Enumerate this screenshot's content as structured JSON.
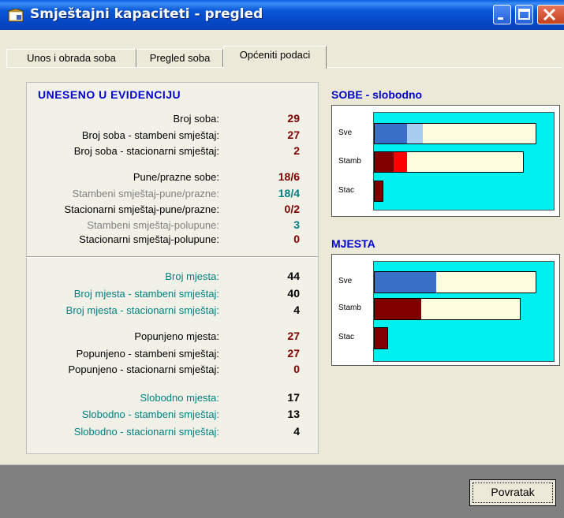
{
  "window": {
    "title": "Smještajni kapaciteti - pregled"
  },
  "tabs": [
    {
      "label": "Unos i obrada soba",
      "active": false
    },
    {
      "label": "Pregled soba",
      "active": false
    },
    {
      "label": "Općeniti podaci",
      "active": true
    }
  ],
  "panel": {
    "title": "UNESENO U EVIDENCIJU",
    "rows": [
      {
        "label": "Broj soba:",
        "value": "29",
        "label_color": "#000000",
        "value_color": "#800000"
      },
      {
        "label": "Broj soba - stambeni smještaj:",
        "value": "27",
        "label_color": "#000000",
        "value_color": "#800000"
      },
      {
        "label": "Broj soba - stacionarni smještaj:",
        "value": "2",
        "label_color": "#000000",
        "value_color": "#800000"
      },
      {
        "label": "Pune/prazne sobe:",
        "value": "18/6",
        "label_color": "#000000",
        "value_color": "#800000"
      },
      {
        "label": "Stambeni smještaj-pune/prazne:",
        "value": "18/4",
        "label_color": "#808080",
        "value_color": "#008080"
      },
      {
        "label": "Stacionarni smještaj-pune/prazne:",
        "value": "0/2",
        "label_color": "#000000",
        "value_color": "#800000"
      },
      {
        "label": "Stambeni smještaj-polupune:",
        "value": "3",
        "label_color": "#808080",
        "value_color": "#008080"
      },
      {
        "label": "Stacionarni smještaj-polupune:",
        "value": "0",
        "label_color": "#000000",
        "value_color": "#800000"
      },
      {
        "label": "Broj mjesta:",
        "value": "44",
        "label_color": "#008080",
        "value_color": "#000000"
      },
      {
        "label": "Broj mjesta - stambeni smještaj:",
        "value": "40",
        "label_color": "#008080",
        "value_color": "#000000"
      },
      {
        "label": "Broj mjesta - stacionarni smještaj:",
        "value": "4",
        "label_color": "#008080",
        "value_color": "#000000"
      },
      {
        "label": "Popunjeno mjesta:",
        "value": "27",
        "label_color": "#000000",
        "value_color": "#800000"
      },
      {
        "label": "Popunjeno - stambeni smještaj:",
        "value": "27",
        "label_color": "#000000",
        "value_color": "#800000"
      },
      {
        "label": "Popunjeno - stacionarni smještaj:",
        "value": "0",
        "label_color": "#000000",
        "value_color": "#800000"
      },
      {
        "label": "Slobodno mjesta:",
        "value": "17",
        "label_color": "#008080",
        "value_color": "#000000"
      },
      {
        "label": "Slobodno - stambeni smještaj:",
        "value": "13",
        "label_color": "#008080",
        "value_color": "#000000"
      },
      {
        "label": "Slobodno - stacionarni smještaj:",
        "value": "4",
        "label_color": "#008080",
        "value_color": "#000000"
      }
    ]
  },
  "charts": {
    "sobe": {
      "title": "SOBE - slobodno",
      "categories": [
        "Sve",
        "Stamb",
        "Stac"
      ],
      "bars": [
        {
          "segments": [
            {
              "fraction": 0.2,
              "color": "#3a6fc8"
            },
            {
              "fraction": 0.1,
              "color": "#a8ccf0"
            }
          ]
        },
        {
          "segments": [
            {
              "fraction": 0.13,
              "color": "#800000"
            },
            {
              "fraction": 0.09,
              "color": "#ff0000"
            }
          ]
        },
        {
          "segments": [
            {
              "fraction": 1.0,
              "color": "#800000"
            }
          ]
        }
      ]
    },
    "mjesta": {
      "title": "MJESTA",
      "categories": [
        "Sve",
        "Stamb",
        "Stac"
      ],
      "bars": [
        {
          "segments": [
            {
              "fraction": 0.38,
              "color": "#3a6fc8"
            }
          ]
        },
        {
          "segments": [
            {
              "fraction": 0.32,
              "color": "#800000"
            }
          ]
        },
        {
          "segments": [
            {
              "fraction": 1.0,
              "color": "#800000"
            }
          ]
        }
      ]
    }
  },
  "footer": {
    "back_label": "Povratak"
  }
}
